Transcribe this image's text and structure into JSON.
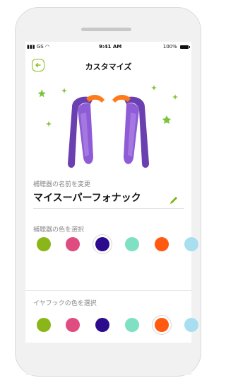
{
  "status": {
    "carrier": "GS",
    "time": "9:41 AM",
    "battery": "100%"
  },
  "header": {
    "title": "カスタマイズ"
  },
  "name_section": {
    "label": "補聴器の名前を変更",
    "value": "マイスーパーフォナック"
  },
  "hearing_aid_colors": {
    "label": "補聴器の色を選択",
    "swatches": [
      {
        "name": "lime",
        "color": "#8bb61a"
      },
      {
        "name": "pink",
        "color": "#df4c80"
      },
      {
        "name": "indigo",
        "color": "#2c0c8c",
        "selected": true
      },
      {
        "name": "mint",
        "color": "#7fe0c3"
      },
      {
        "name": "orange",
        "color": "#ff5a10"
      },
      {
        "name": "light-blue",
        "color": "#a8dff0"
      }
    ]
  },
  "earhook_colors": {
    "label": "イヤフックの色を選択",
    "swatches": [
      {
        "name": "lime",
        "color": "#8bb61a"
      },
      {
        "name": "pink",
        "color": "#df4c80"
      },
      {
        "name": "indigo",
        "color": "#2c0c8c"
      },
      {
        "name": "mint",
        "color": "#7fe0c3"
      },
      {
        "name": "orange",
        "color": "#ff5a10",
        "selected": true
      },
      {
        "name": "light-blue",
        "color": "#a8dff0"
      }
    ]
  },
  "colors": {
    "accent": "#8bbd1c"
  }
}
